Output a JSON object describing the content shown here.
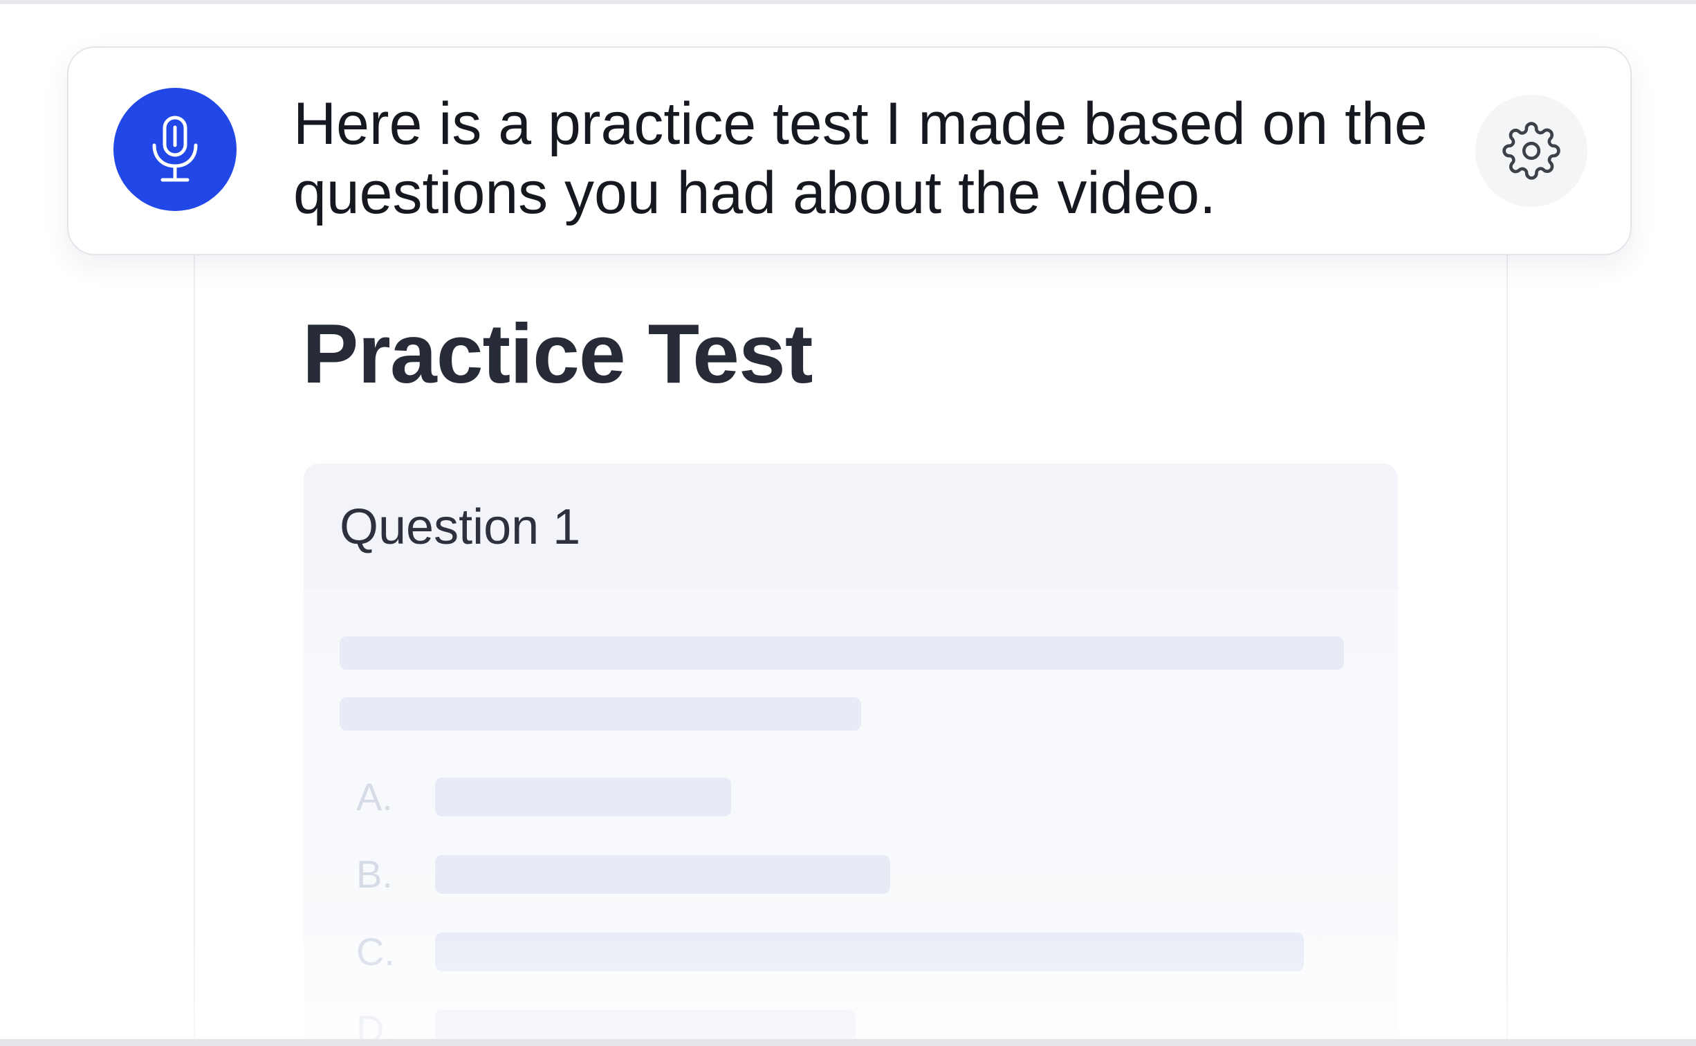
{
  "assistant": {
    "message": "Here is a practice test I made based on the questions you had about the video.",
    "mic_icon": "microphone-icon",
    "settings_icon": "gear-icon",
    "accent_color": "#2147e6"
  },
  "document": {
    "title": "Practice Test",
    "questions": [
      {
        "label": "Question 1",
        "options": [
          {
            "letter": "A."
          },
          {
            "letter": "B."
          },
          {
            "letter": "C."
          },
          {
            "letter": "D."
          }
        ]
      }
    ]
  }
}
